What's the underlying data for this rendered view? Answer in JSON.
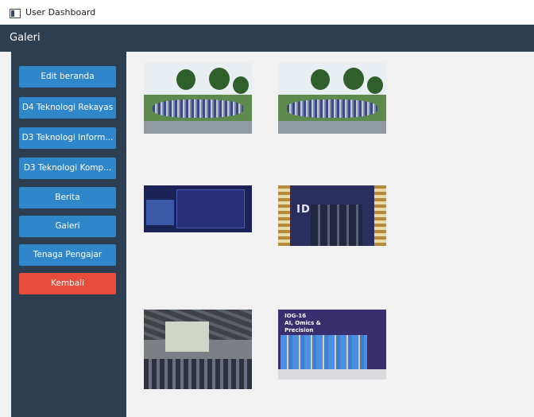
{
  "window": {
    "title": "User Dashboard"
  },
  "header": {
    "title": "Galeri"
  },
  "sidebar": {
    "buttons": [
      {
        "label": "Edit beranda"
      },
      {
        "label": "D4 Teknologi Rekayas"
      },
      {
        "label": "D3 Teknologi Inform..."
      },
      {
        "label": "D3 Teknologi Komp..."
      },
      {
        "label": "Berita"
      },
      {
        "label": "Galeri"
      },
      {
        "label": "Tenaga Pengajar"
      },
      {
        "label": "Kembali"
      }
    ]
  },
  "gallery": {
    "images": [
      {
        "icon": "group-photo-outdoor"
      },
      {
        "icon": "group-photo-outdoor"
      },
      {
        "icon": "presentation-slide"
      },
      {
        "icon": "award-stage-photo",
        "text": "IDE ST"
      },
      {
        "icon": "auditorium-photo"
      },
      {
        "icon": "conference-group-photo",
        "text": "IOG-16\nAI, Omics &\nPrecision"
      }
    ]
  },
  "colors": {
    "nav_dark": "#2c3e50",
    "button_blue": "#2f86c8",
    "button_red": "#e74c3c",
    "content_bg": "#f1f1f1"
  }
}
